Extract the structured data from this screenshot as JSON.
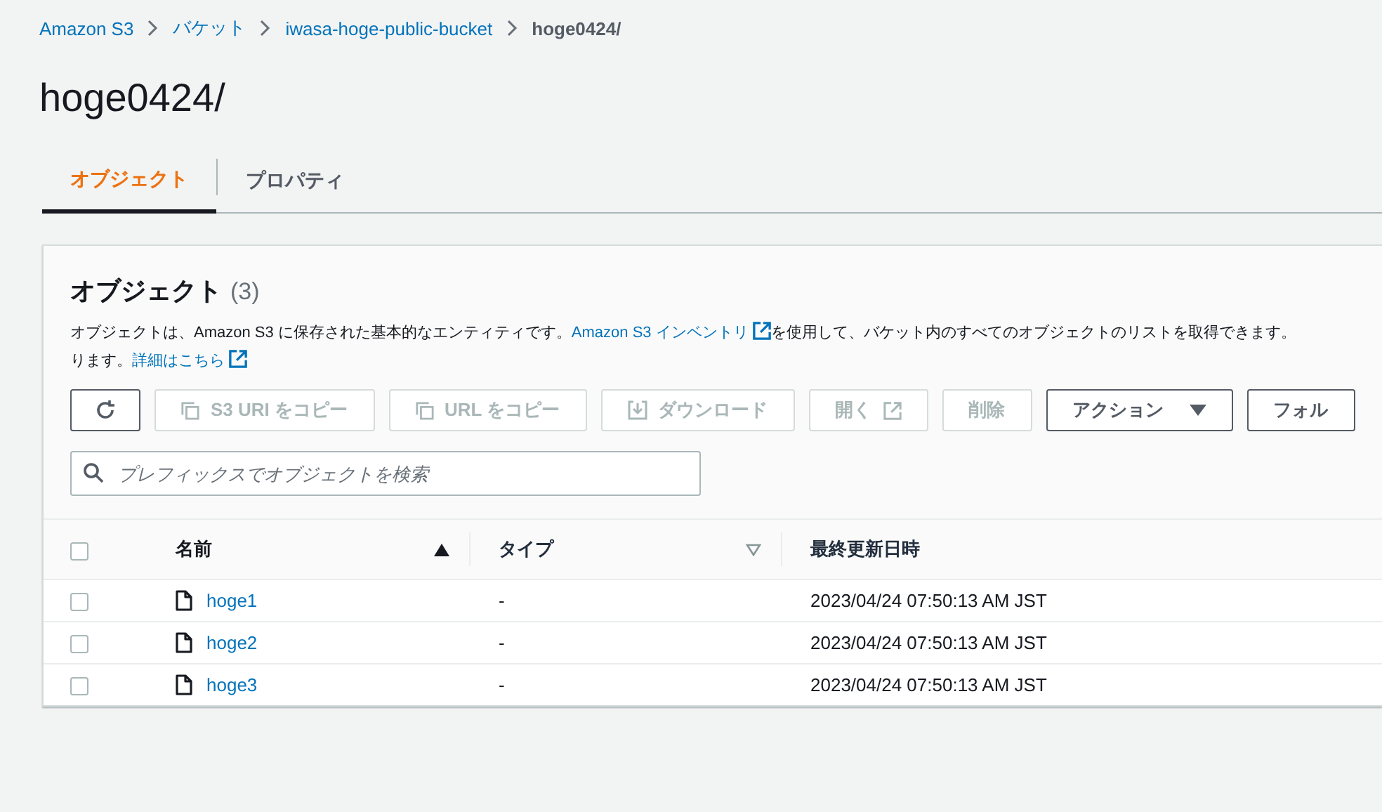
{
  "breadcrumb": [
    {
      "label": "Amazon S3",
      "kind": "link"
    },
    {
      "label": "バケット",
      "kind": "link"
    },
    {
      "label": "iwasa-hoge-public-bucket",
      "kind": "link"
    },
    {
      "label": "hoge0424/",
      "kind": "current"
    }
  ],
  "title": "hoge0424/",
  "tabs": [
    {
      "label": "オブジェクト",
      "selected": true
    },
    {
      "label": "プロパティ",
      "selected": false
    }
  ],
  "objects_panel": {
    "heading": "オブジェクト",
    "count": "(3)",
    "description": {
      "line_1_start": "オブジェクトは、Amazon S3 に保存された基本的なエンティティです。",
      "inventory_link": "Amazon S3 インベントリ",
      "line_1_end": "を使用して、バケット内のすべてのオブジェクトのリストを取得できます。",
      "line_2_start": "ります。",
      "details_link": "詳細はこちら"
    },
    "buttons": [
      {
        "kind": "refresh",
        "disabled": false
      },
      {
        "kind": "copy",
        "label": "S3 URI をコピー",
        "disabled": true
      },
      {
        "kind": "copy",
        "label": "URL をコピー",
        "disabled": true
      },
      {
        "kind": "download",
        "label": "ダウンロード",
        "disabled": true
      },
      {
        "kind": "external",
        "label": "開く",
        "disabled": true
      },
      {
        "kind": "plain",
        "label": "削除",
        "disabled": true
      },
      {
        "kind": "dropdown",
        "label": "アクション",
        "disabled": false
      },
      {
        "kind": "plain",
        "label": "フォル",
        "disabled": false
      }
    ],
    "search": {
      "placeholder": "プレフィックスでオブジェクトを検索"
    },
    "table": {
      "select_all": {
        "checked": false
      },
      "columns": [
        {
          "label": "名前",
          "sorted": true
        },
        {
          "label": "タイプ",
          "sorted": false
        },
        {
          "label": "最終更新日時"
        }
      ],
      "rows": [
        {
          "checked": false,
          "name": "hoge1",
          "type": "-",
          "last_modified": "2023/04/24 07:50:13 AM JST"
        },
        {
          "checked": false,
          "name": "hoge2",
          "type": "-",
          "last_modified": "2023/04/24 07:50:13 AM JST"
        },
        {
          "checked": false,
          "name": "hoge3",
          "type": "-",
          "last_modified": "2023/04/24 07:50:13 AM JST"
        }
      ]
    }
  }
}
